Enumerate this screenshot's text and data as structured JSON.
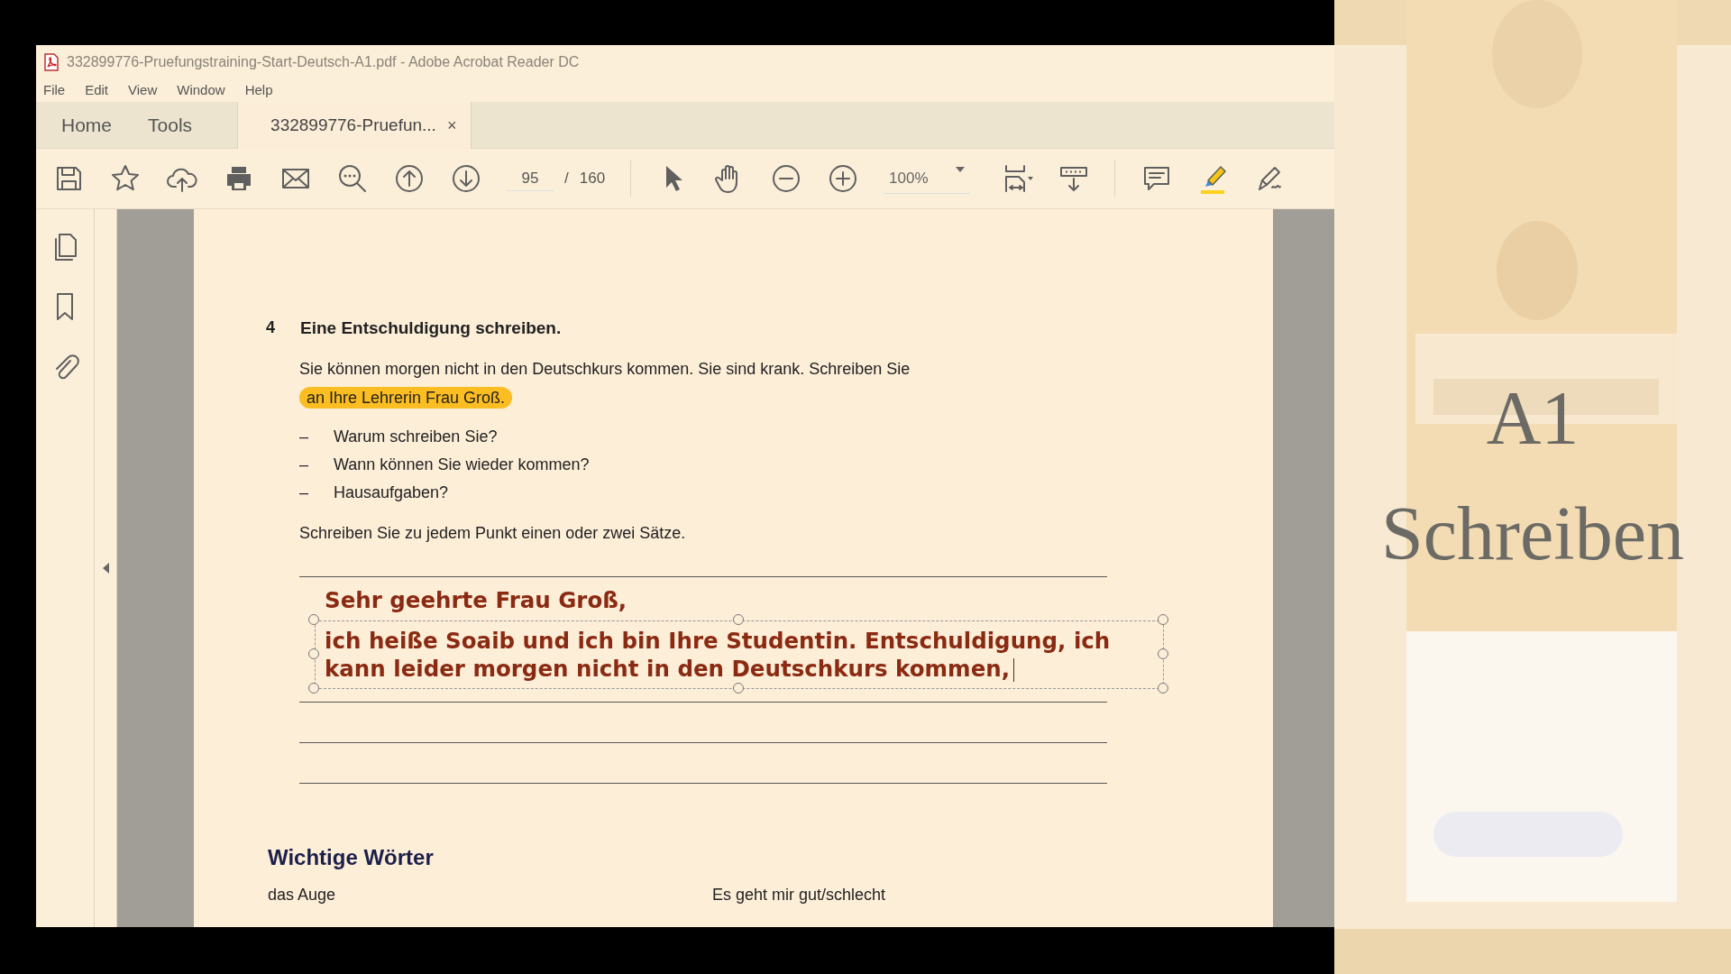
{
  "window": {
    "title": "332899776-Pruefungstraining-Start-Deutsch-A1.pdf - Adobe Acrobat Reader DC"
  },
  "menu": [
    "File",
    "Edit",
    "View",
    "Window",
    "Help"
  ],
  "tabs": [
    {
      "label": "Home",
      "selected": false
    },
    {
      "label": "Tools",
      "selected": false
    },
    {
      "label": "332899776-Pruefun...",
      "selected": true,
      "close": "×"
    }
  ],
  "toolbar": {
    "page": "95",
    "page_separator": "/",
    "page_count": "160",
    "zoom": "100%"
  },
  "document": {
    "task_number": "4",
    "task_title": "Eine Entschuldigung schreiben.",
    "instruction": "Sie können morgen nicht in den Deutschkurs kommen. Sie sind krank. Schreiben Sie ",
    "highlighted": "an Ihre Lehrerin Frau Groß.",
    "bullets": [
      {
        "dash": "–",
        "text": "Warum schreiben Sie?"
      },
      {
        "dash": "–",
        "text": "Wann können Sie wieder kommen?"
      },
      {
        "dash": "–",
        "text": "Hausaufgaben?"
      }
    ],
    "closing": "Schreiben Sie zu jedem Punkt einen oder zwei Sätze.",
    "greeting": "Sehr geehrte Frau Groß,",
    "annotation_lines": [
      "ich heiße Soaib und ich bin Ihre Studentin. Entschuldigung, ich",
      "kann leider morgen nicht in den Deutschkurs kommen,"
    ],
    "section_title": "Wichtige Wörter",
    "vocabulary": [
      "das Auge",
      "Es geht mir gut/schlecht"
    ]
  },
  "overlay": {
    "kind": "picture",
    "title_lines": [
      "A1",
      "Schreiben"
    ]
  }
}
